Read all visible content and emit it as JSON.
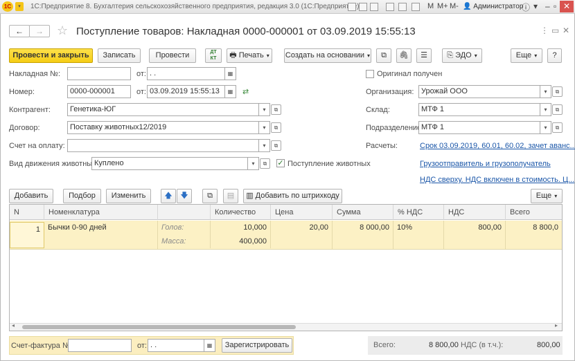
{
  "window": {
    "title": "1С:Предприятие 8. Бухгалтерия сельскохозяйственного предприятия, редакция 3.0  (1С:Предприятие)",
    "user": "Администратор",
    "m_labels": [
      "M",
      "M+",
      "M-"
    ]
  },
  "document": {
    "title": "Поступление товаров: Накладная 0000-000001 от 03.09.2019 15:55:13"
  },
  "toolbar": {
    "post_close": "Провести и закрыть",
    "save": "Записать",
    "post": "Провести",
    "dtkt": "ДТ КТ",
    "print": "Печать",
    "create_based": "Создать на основании",
    "edo": "ЭДО",
    "more": "Еще",
    "help": "?"
  },
  "form": {
    "invoice_no_label": "Накладная №:",
    "invoice_no_value": "",
    "from_label": "от:",
    "invoice_date_value": " .  .",
    "number_label": "Номер:",
    "number_value": "0000-000001",
    "number_date_value": "03.09.2019 15:55:13",
    "counterparty_label": "Контрагент:",
    "counterparty_value": "Генетика-ЮГ",
    "contract_label": "Договор:",
    "contract_value": "Поставку животных12/2019",
    "payment_label": "Счет на оплату:",
    "payment_value": "",
    "movement_label": "Вид движения животных:",
    "movement_value": "Куплено",
    "animal_receipt_label": "Поступление животных",
    "original_label": "Оригинал получен",
    "org_label": "Организация:",
    "org_value": "Урожай ООО",
    "warehouse_label": "Склад:",
    "warehouse_value": "МТФ 1",
    "division_label": "Подразделение:",
    "division_value": "МТФ 1",
    "settlements_label": "Расчеты:",
    "settlements_link": "Срок 03.09.2019, 60.01, 60.02, зачет аванс...",
    "shipper_link": "Грузоотправитель и грузополучатель",
    "vat_link": "НДС сверху. НДС включен в стоимость. Ц..."
  },
  "table_toolbar": {
    "add": "Добавить",
    "select": "Подбор",
    "change": "Изменить",
    "barcode": "Добавить по штрихкоду",
    "more": "Еще"
  },
  "table": {
    "headers": [
      "N",
      "Номенклатура",
      "",
      "Количество",
      "Цена",
      "Сумма",
      "% НДС",
      "НДС",
      "Всего"
    ],
    "rows": [
      {
        "n": "1",
        "item": "Бычки 0-90 дней",
        "heads_label": "Голов:",
        "heads_value": "10,000",
        "mass_label": "Масса:",
        "mass_value": "400,000",
        "price": "20,00",
        "sum": "8 000,00",
        "vat_rate": "10%",
        "vat": "800,00",
        "total": "8 800,0"
      }
    ]
  },
  "footer": {
    "invoice_label": "Счет-фактура №:",
    "invoice_value": "",
    "from_label": "от:",
    "date_value": " .  .",
    "register": "Зарегистрировать",
    "total_label": "Всего:",
    "total_value": "8 800,00",
    "vat_label": "НДС (в т.ч.):",
    "vat_value": "800,00"
  },
  "accent_colors": {
    "primary_button": "#f5cd16",
    "link": "#1a56a8",
    "row_highlight": "#fcf1c5"
  }
}
